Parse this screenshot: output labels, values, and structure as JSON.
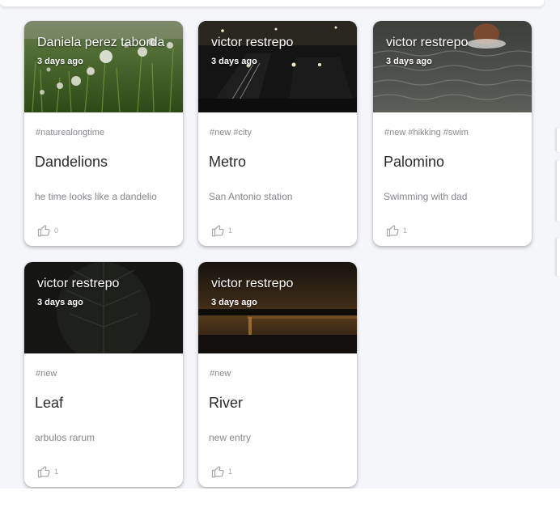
{
  "cards": [
    {
      "author": "Daniela perez taborda",
      "date": "3 days ago",
      "tags": "#naturealongtime",
      "title": "Dandelions",
      "description": "he time looks like a dandelio",
      "likes": "0",
      "image": "dandelion-field-photo"
    },
    {
      "author": "victor restrepo",
      "date": "3 days ago",
      "tags": "#new #city",
      "title": "Metro",
      "description": "San Antonio station",
      "likes": "1",
      "image": "metro-station-night-photo"
    },
    {
      "author": "victor restrepo",
      "date": "3 days ago",
      "tags": "#new #hikking #swim",
      "title": "Palomino",
      "description": "Swimming with dad",
      "likes": "1",
      "image": "river-swimmer-photo"
    },
    {
      "author": "victor restrepo",
      "date": "3 days ago",
      "tags": "#new",
      "title": "Leaf",
      "description": "arbulos rarum",
      "likes": "1",
      "image": "dark-leaf-photo"
    },
    {
      "author": "victor restrepo",
      "date": "3 days ago",
      "tags": "#new",
      "title": "River",
      "description": "new entry",
      "likes": "1",
      "image": "river-sunset-photo"
    }
  ],
  "icons": {
    "like": "thumb-up-icon"
  },
  "colors": {
    "background": "#f5f6fa",
    "card": "#ffffff",
    "title_text": "#2b2b2e",
    "muted_text": "#84868c"
  }
}
